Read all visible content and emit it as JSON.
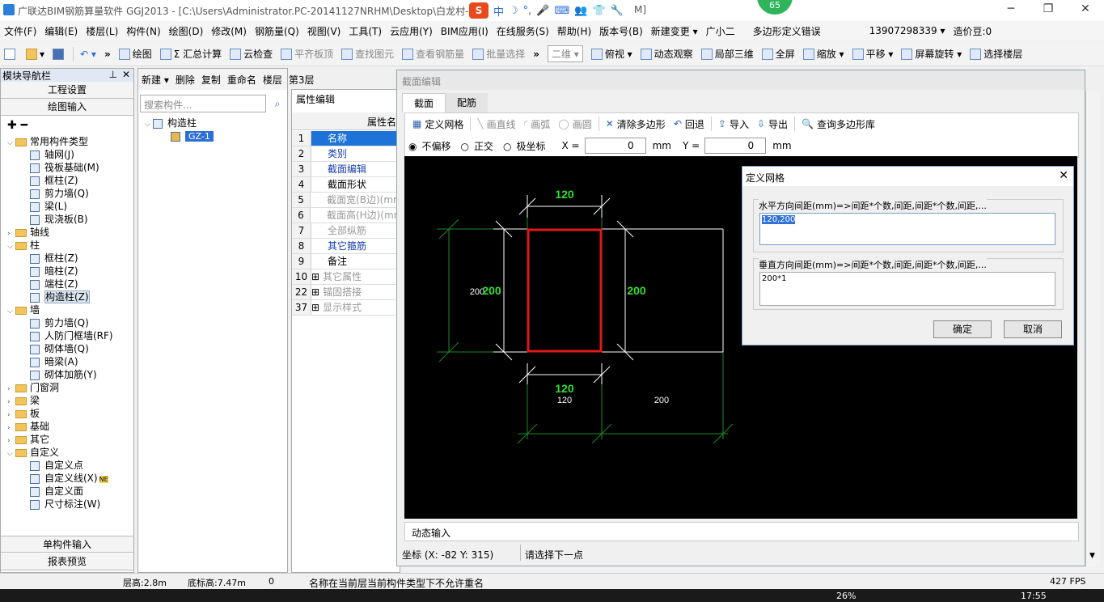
{
  "window": {
    "title": "广联达BIM钢筋算量软件 GGJ2013 - [C:\\Users\\Administrator.PC-20141127NRHM\\Desktop\\白龙村-",
    "title_tail": "M]",
    "badge": "65"
  },
  "ime": {
    "s": "S",
    "items": [
      "中",
      "☽",
      "°,",
      "🎤",
      "⌨",
      "👥",
      "👕",
      "🔧"
    ]
  },
  "menu": [
    "文件(F)",
    "编辑(E)",
    "楼层(L)",
    "构件(N)",
    "绘图(D)",
    "修改(M)",
    "钢筋量(Q)",
    "视图(V)",
    "工具(T)",
    "云应用(Y)",
    "BIM应用(I)",
    "在线服务(S)",
    "帮助(H)",
    "版本号(B)",
    "新建变更 ▾",
    "广小二",
    "多边形定义错误",
    "13907298339 ▾",
    "造价豆:0"
  ],
  "toolbar": {
    "left": [
      "绘图",
      "Σ 汇总计算",
      "云检查",
      "平齐板顶",
      "查找图元",
      "查看钢筋量",
      "批量选择"
    ],
    "view": "二维",
    "right": [
      "俯视 ▾",
      "动态观察",
      "局部三维",
      "全屏",
      "缩放 ▾",
      "平移 ▾",
      "屏幕旋转 ▾",
      "选择楼层"
    ]
  },
  "nav": {
    "title": "模块导航栏",
    "project_settings": "工程设置",
    "draw_input": "绘图输入",
    "single_input": "单构件输入",
    "report": "报表预览",
    "tree": [
      {
        "label": "常用构件类型",
        "level": 0,
        "type": "folder",
        "open": true
      },
      {
        "label": "轴网(J)",
        "level": 1,
        "type": "leaf"
      },
      {
        "label": "筏板基础(M)",
        "level": 1,
        "type": "leaf"
      },
      {
        "label": "框柱(Z)",
        "level": 1,
        "type": "leaf"
      },
      {
        "label": "剪力墙(Q)",
        "level": 1,
        "type": "leaf"
      },
      {
        "label": "梁(L)",
        "level": 1,
        "type": "leaf"
      },
      {
        "label": "现浇板(B)",
        "level": 1,
        "type": "leaf"
      },
      {
        "label": "轴线",
        "level": 0,
        "type": "folder",
        "open": false
      },
      {
        "label": "柱",
        "level": 0,
        "type": "folder",
        "open": true
      },
      {
        "label": "框柱(Z)",
        "level": 1,
        "type": "leaf"
      },
      {
        "label": "暗柱(Z)",
        "level": 1,
        "type": "leaf"
      },
      {
        "label": "端柱(Z)",
        "level": 1,
        "type": "leaf"
      },
      {
        "label": "构造柱(Z)",
        "level": 1,
        "type": "leaf",
        "selected": true
      },
      {
        "label": "墙",
        "level": 0,
        "type": "folder",
        "open": true
      },
      {
        "label": "剪力墙(Q)",
        "level": 1,
        "type": "leaf"
      },
      {
        "label": "人防门框墙(RF)",
        "level": 1,
        "type": "leaf"
      },
      {
        "label": "砌体墙(Q)",
        "level": 1,
        "type": "leaf"
      },
      {
        "label": "暗梁(A)",
        "level": 1,
        "type": "leaf"
      },
      {
        "label": "砌体加筋(Y)",
        "level": 1,
        "type": "leaf"
      },
      {
        "label": "门窗洞",
        "level": 0,
        "type": "folder",
        "open": false
      },
      {
        "label": "梁",
        "level": 0,
        "type": "folder",
        "open": false
      },
      {
        "label": "板",
        "level": 0,
        "type": "folder",
        "open": false
      },
      {
        "label": "基础",
        "level": 0,
        "type": "folder",
        "open": false
      },
      {
        "label": "其它",
        "level": 0,
        "type": "folder",
        "open": false
      },
      {
        "label": "自定义",
        "level": 0,
        "type": "folder",
        "open": true
      },
      {
        "label": "自定义点",
        "level": 1,
        "type": "leaf"
      },
      {
        "label": "自定义线(X)",
        "level": 1,
        "type": "leaf",
        "badge": "NE"
      },
      {
        "label": "自定义面",
        "level": 1,
        "type": "leaf"
      },
      {
        "label": "尺寸标注(W)",
        "level": 1,
        "type": "leaf"
      }
    ]
  },
  "comp": {
    "toolbar": [
      "新建 ▾",
      "删除",
      "复制",
      "重命名",
      "楼层",
      "第3层"
    ],
    "search_placeholder": "搜索构件...",
    "root": "构造柱",
    "child": "GZ-1"
  },
  "props": {
    "tab": "属性编辑",
    "header": "属性名",
    "rows": [
      {
        "n": "1",
        "v": "名称",
        "style": "sel"
      },
      {
        "n": "2",
        "v": "类别",
        "style": "blue"
      },
      {
        "n": "3",
        "v": "截面编辑",
        "style": "blue"
      },
      {
        "n": "4",
        "v": "截面形状",
        "style": ""
      },
      {
        "n": "5",
        "v": "截面宽(B边)(mm",
        "style": "gray"
      },
      {
        "n": "6",
        "v": "截面高(H边)(mm",
        "style": "gray"
      },
      {
        "n": "7",
        "v": "全部纵筋",
        "style": "gray"
      },
      {
        "n": "8",
        "v": "其它箍筋",
        "style": "blue"
      },
      {
        "n": "9",
        "v": "备注",
        "style": ""
      },
      {
        "n": "10",
        "v": "其它属性",
        "style": "gray",
        "plus": true
      },
      {
        "n": "22",
        "v": "锚固搭接",
        "style": "gray",
        "plus": true
      },
      {
        "n": "37",
        "v": "显示样式",
        "style": "gray",
        "plus": true
      }
    ]
  },
  "section": {
    "title": "截面编辑",
    "tabs": [
      "截面",
      "配筋"
    ],
    "tools": [
      "定义网格",
      "画直线",
      "画弧",
      "画圆",
      "清除多边形",
      "回退",
      "导入",
      "导出",
      "查询多边形库"
    ],
    "radios": [
      "不偏移",
      "正交",
      "极坐标"
    ],
    "x_label": "X =",
    "y_label": "Y =",
    "x": "0",
    "y": "0",
    "unit": "mm",
    "dyn_input": "动态输入",
    "coord": "坐标 (X: -82 Y: 315)",
    "prompt": "请选择下一点",
    "dims": {
      "top": "120",
      "bottom_green": "120",
      "bottom_white": "120",
      "bottom_right": "200",
      "left_white": "200",
      "left_green": "200",
      "right_green": "200"
    }
  },
  "grid_dialog": {
    "title": "定义网格",
    "h_label": "水平方向间距(mm)=>间距*个数,间距,间距*个数,间距,...",
    "h_value": "120,200",
    "v_label": "垂直方向间距(mm)=>间距*个数,间距,间距*个数,间距,...",
    "v_value": "200*1",
    "ok": "确定",
    "cancel": "取消"
  },
  "status": {
    "floor_h": "层高:2.8m",
    "base_h": "底标高:7.47m",
    "zero": "0",
    "msg": "名称在当前层当前构件类型下不允许重名",
    "fps": "427 FPS"
  },
  "taskbar": {
    "battery": "26%",
    "time": "17:55"
  }
}
